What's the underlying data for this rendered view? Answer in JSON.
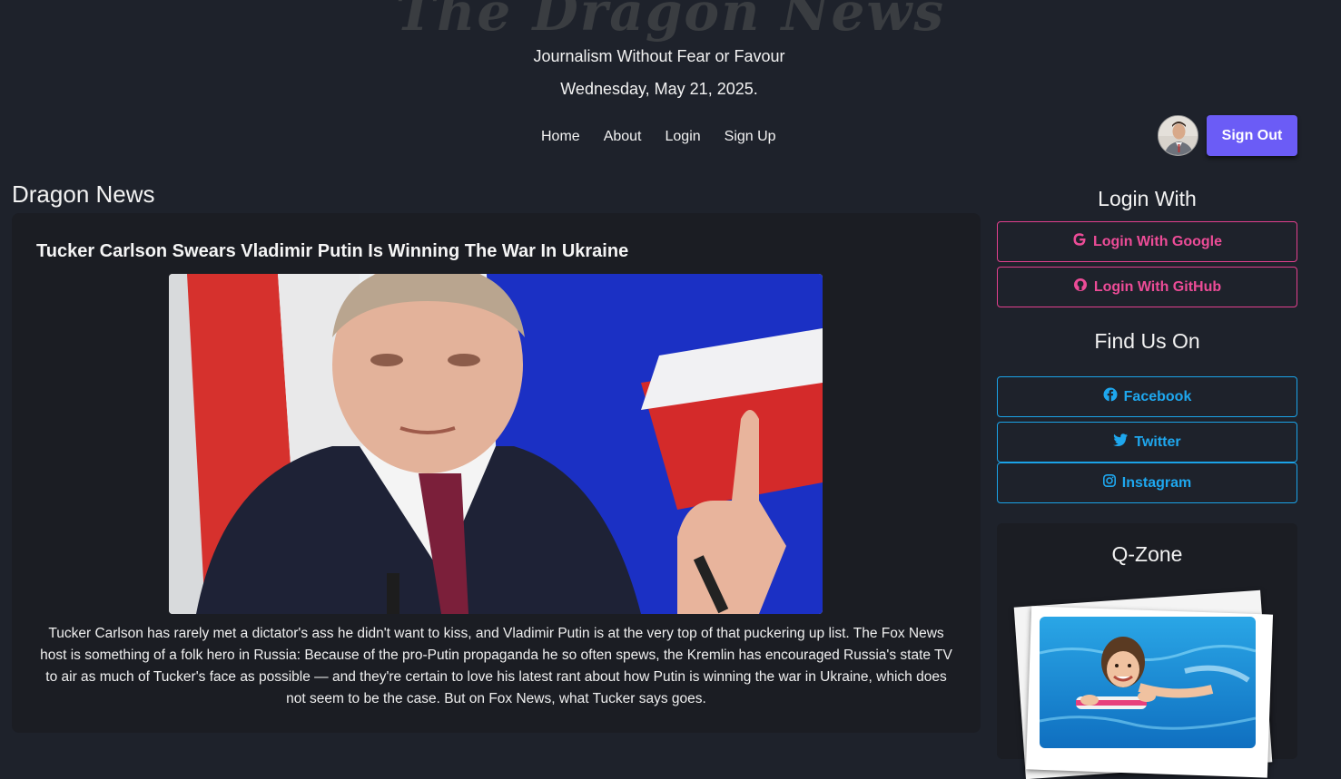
{
  "header": {
    "masthead": "The Dragon News",
    "tagline": "Journalism Without Fear or Favour",
    "date": "Wednesday, May 21, 2025."
  },
  "nav": {
    "items": [
      "Home",
      "About",
      "Login",
      "Sign Up"
    ]
  },
  "user": {
    "avatar_icon": "user-avatar",
    "signout_label": "Sign Out"
  },
  "main": {
    "section_title": "Dragon News",
    "article": {
      "title": "Tucker Carlson Swears Vladimir Putin Is Winning The War In Ukraine",
      "body": "Tucker Carlson has rarely met a dictator's ass he didn't want to kiss, and Vladimir Putin is at the very top of that puckering up list. The Fox News host is something of a folk hero in Russia: Because of the pro-Putin propaganda he so often spews, the Kremlin has encouraged Russia's state TV to air as much of Tucker's face as possible — and they're certain to love his latest rant about how Putin is winning the war in Ukraine, which does not seem to be the case. But on Fox News, what Tucker says goes."
    }
  },
  "sidebar": {
    "login_heading": "Login With",
    "login_google": "Login With Google",
    "login_github": "Login With GitHub",
    "find_heading": "Find Us On",
    "facebook": "Facebook",
    "twitter": "Twitter",
    "instagram": "Instagram",
    "qzone_heading": "Q-Zone"
  },
  "colors": {
    "background": "#1e222b",
    "accent": "#6b5cf6",
    "pink": "#e2408e",
    "blue": "#1ba3e8"
  }
}
